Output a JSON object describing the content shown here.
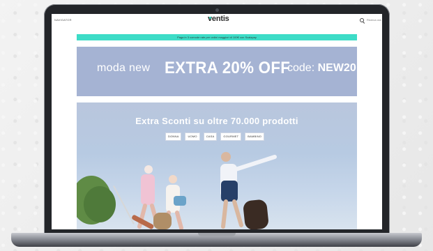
{
  "header": {
    "menu_label": "NAVIGATOR",
    "logo": "ventis",
    "search_label": "Ricerca ora"
  },
  "promo_strip": {
    "text": "Paga in 3 comode rate per ordini maggiori di 100€ con Scalapay"
  },
  "banner": {
    "left": "moda new",
    "main": "EXTRA 20% OFF",
    "code_prefix": "code:",
    "code": "NEW20"
  },
  "hero": {
    "title": "Extra Sconti su oltre 70.000 prodotti",
    "categories": [
      "DONNA",
      "UOMO",
      "CASA",
      "GOURMET",
      "BAMBINO"
    ]
  },
  "colors": {
    "accent": "#3ddcc7",
    "banner_bg": "#a5b3d3",
    "laptop_frame": "#232529"
  }
}
